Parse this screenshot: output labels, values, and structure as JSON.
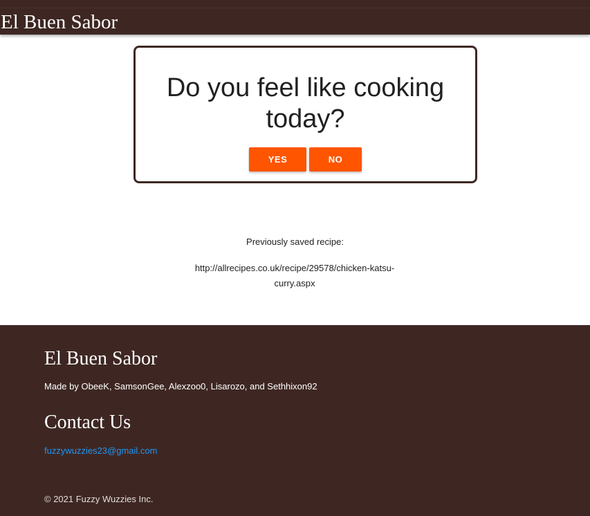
{
  "navbar": {
    "brand": "El Buen Sabor"
  },
  "prompt": {
    "question": "Do you feel like cooking today?",
    "yes_label": "YES",
    "no_label": "NO"
  },
  "saved": {
    "label": "Previously saved recipe:",
    "url": "http://allrecipes.co.uk/recipe/29578/chicken-katsu-curry.aspx"
  },
  "footer": {
    "title": "El Buen Sabor",
    "credits": "Made by ObeeK, SamsonGee, Alexzoo0, Lisarozo, and Sethhixon92",
    "contact_heading": "Contact Us",
    "email": "fuzzywuzzies23@gmail.com",
    "copyright": "© 2021 Fuzzy Wuzzies Inc."
  },
  "colors": {
    "brand_brown": "#3e2723",
    "accent_orange": "#ff5500",
    "link_blue": "#2196f3"
  }
}
